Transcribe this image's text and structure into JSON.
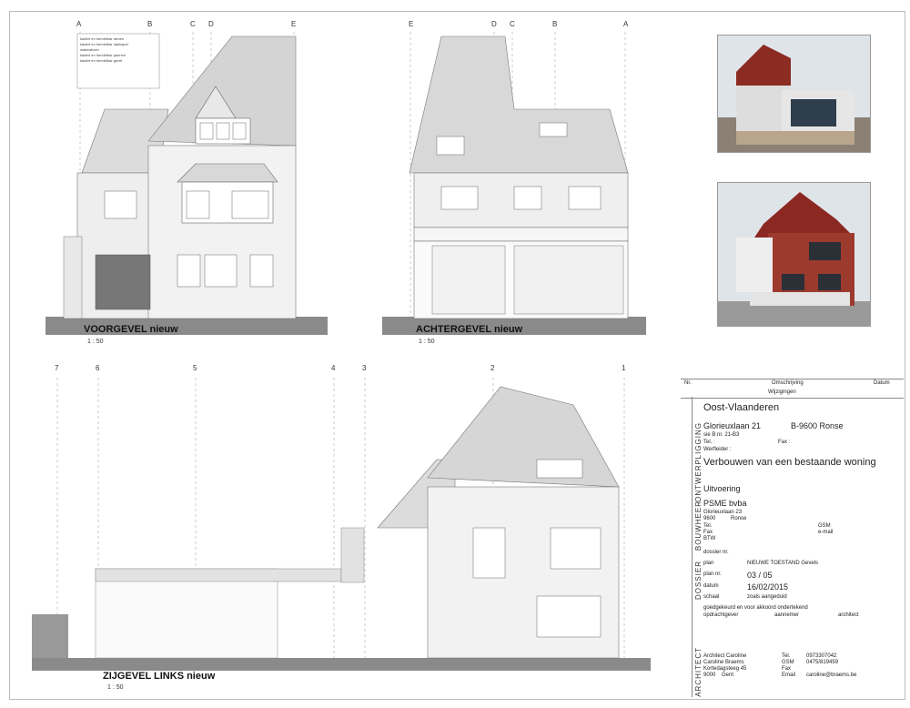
{
  "views": {
    "front": {
      "title": "VOORGEVEL nieuw",
      "scale": "1 : 50",
      "grid": [
        "A",
        "B",
        "C",
        "D",
        "E"
      ]
    },
    "back": {
      "title": "ACHTERGEVEL nieuw",
      "scale": "1 : 50",
      "grid": [
        "E",
        "D",
        "C",
        "B",
        "A"
      ]
    },
    "side": {
      "title": "ZIJGEVEL LINKS nieuw",
      "scale": "1 : 50",
      "grid": [
        "7",
        "6",
        "5",
        "4",
        "3",
        "2",
        "1"
      ]
    }
  },
  "notes": {
    "front": [
      "kadert en hendelbar ramen",
      "kadert en hendelbar dakkapel",
      "waterafvoer",
      "kadert en hendelbar pannen",
      "kadert en hendelbar gevel"
    ]
  },
  "revisions": {
    "nr": "Nr.",
    "omschrijving": "Omschrijving",
    "datum": "Datum",
    "wijzigingen": "Wijzigingen"
  },
  "title_block": {
    "region": "Oost-Vlaanderen",
    "ligging_label": "LIGGING",
    "address": "Glorieuxlaan 21",
    "city": "B-9600 Ronse",
    "parcel": "sie B nr. 21-B3",
    "tel_label": "Tel. :",
    "fax_label": "Fax :",
    "werfleider_label": "Werfleider :",
    "ontwerp_label": "ONTWERP",
    "project": "Verbouwen van een bestaande woning",
    "phase": "Uitvoering",
    "bouwheer_label": "BOUWHEER",
    "owner": "PSME bvba",
    "owner_addr": "Glorieuxlaan 23",
    "owner_zip": "9600",
    "owner_city": "Ronse",
    "owner_tel": "Tel.",
    "owner_fax": "Fax",
    "owner_btw": "BTW",
    "owner_gsm": "GSM",
    "owner_email": "e-mail",
    "dossier_label": "DOSSIER",
    "dossier_nr_label": "dossier nr.",
    "plan_label": "plan",
    "plan_value": "NIEUWE TOESTAND Gevels",
    "plan_nr_label": "plan nr.",
    "plan_nr": "03 / 05",
    "datum_label": "datum",
    "datum": "16/02/2015",
    "schaal_label": "schaal",
    "schaal": "zoals aangeduid",
    "approval": "goedgekeurd en voor akkoord ondertekend",
    "opdrachtgever": "opdrachtgever",
    "aannemer": "aannemer",
    "architect_sig": "architect",
    "architect_label": "ARCHITECT",
    "arch_name": "Architect Caroline",
    "arch_name2": "Caroline Braems",
    "arch_street": "Kortedagsteeg 45",
    "arch_zip": "9000",
    "arch_city": "Gent",
    "arch_tel_label": "Tel.",
    "arch_tel": "0973307042",
    "arch_gsm_label": "GSM",
    "arch_gsm": "0475/819459",
    "arch_fax_label": "Fax",
    "arch_email_label": "Email",
    "arch_email": "caroline@braems.be"
  },
  "colors": {
    "roof": "#dcdcdc",
    "wall": "#eeeeee",
    "ground": "#8a8a8a",
    "brick_render": "#9c3a2e"
  }
}
